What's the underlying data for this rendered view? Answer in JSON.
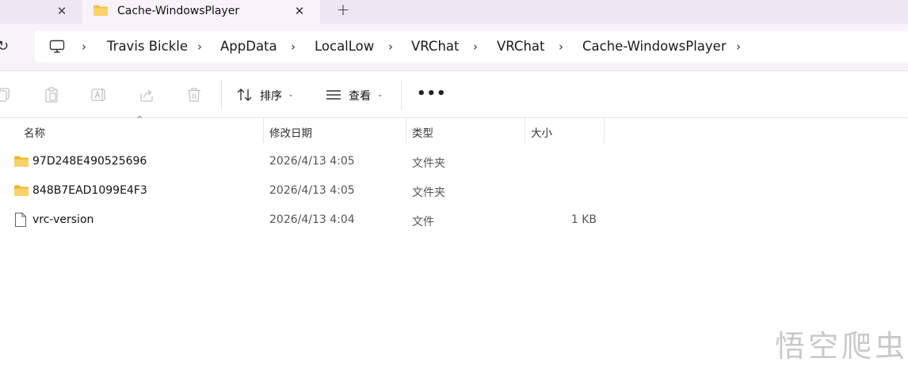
{
  "tabs": {
    "inactive_close": "✕",
    "active_title": "Cache-WindowsPlayer",
    "active_close": "✕",
    "new_tab": "+"
  },
  "address": {
    "refresh": "↻",
    "separator": "›",
    "breadcrumbs": [
      "Travis Bickle",
      "AppData",
      "LocalLow",
      "VRChat",
      "VRChat",
      "Cache-WindowsPlayer"
    ]
  },
  "toolbar": {
    "sort_label": "排序",
    "view_label": "查看",
    "more_label": "•••",
    "caret": "⌄"
  },
  "columns": {
    "name": "名称",
    "modified": "修改日期",
    "type": "类型",
    "size": "大小",
    "sort_indicator": "^"
  },
  "files": [
    {
      "name": "97D248E490525696",
      "modified": "2026/4/13 4:05",
      "type": "文件夹",
      "size": "",
      "icon": "folder-icon"
    },
    {
      "name": "848B7EAD1099E4F3",
      "modified": "2026/4/13 4:05",
      "type": "文件夹",
      "size": "",
      "icon": "folder-icon"
    },
    {
      "name": "vrc-version",
      "modified": "2026/4/13 4:04",
      "type": "文件",
      "size": "1 KB",
      "icon": "file-icon"
    }
  ],
  "watermark": "悟空爬虫",
  "colors": {
    "tab_strip": "#efe6f3",
    "address_bg": "#f7f3f9",
    "folder": "#f6c24a"
  }
}
